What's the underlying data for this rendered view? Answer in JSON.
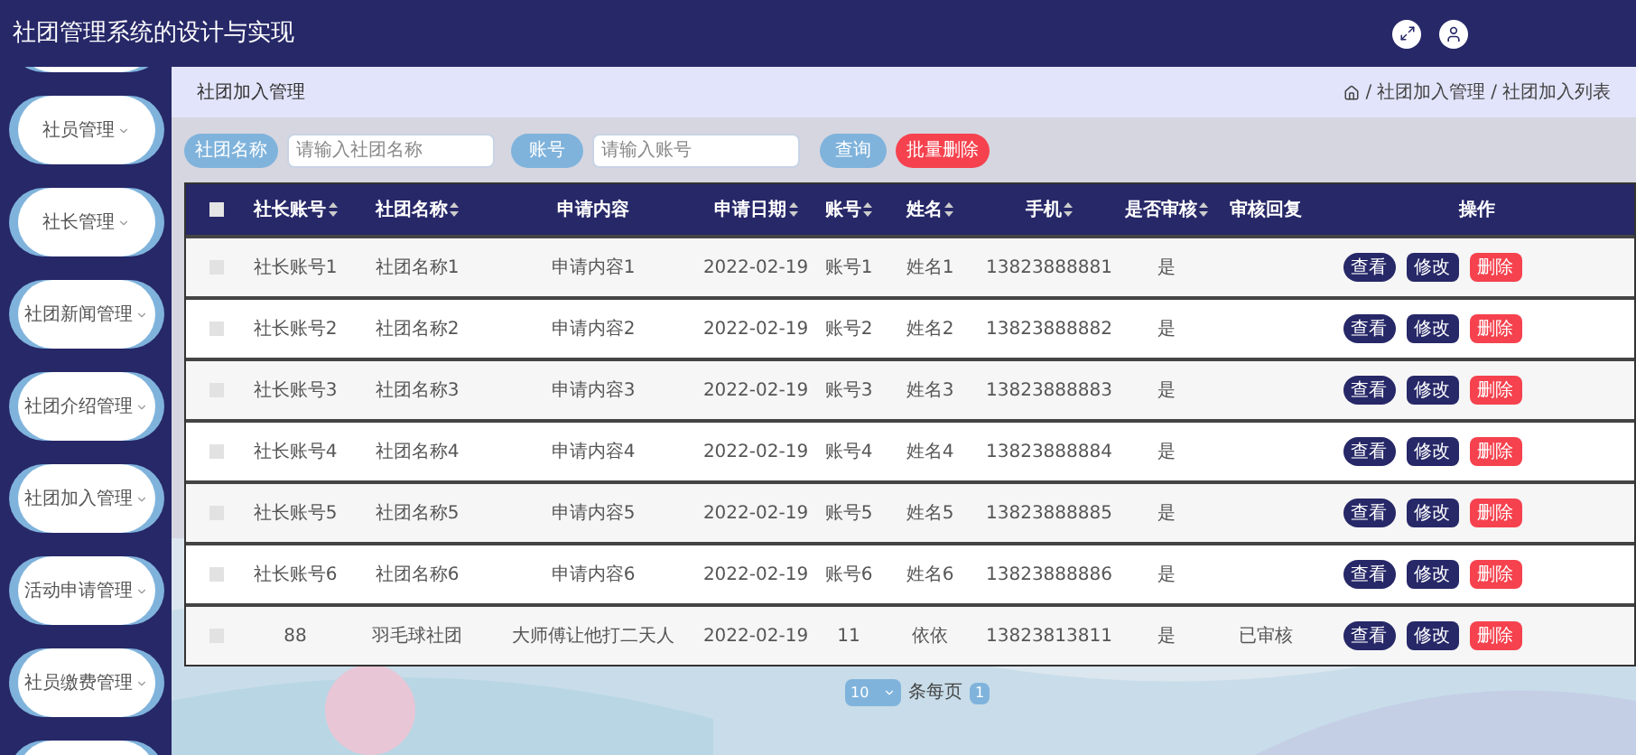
{
  "header": {
    "title": "社团管理系统的设计与实现"
  },
  "sidebar": {
    "items": [
      {
        "label": "社员管理"
      },
      {
        "label": "社长管理"
      },
      {
        "label": "社团新闻管理"
      },
      {
        "label": "社团介绍管理"
      },
      {
        "label": "社团加入管理"
      },
      {
        "label": "活动申请管理"
      },
      {
        "label": "社员缴费管理"
      }
    ]
  },
  "page_title": "社团加入管理",
  "breadcrumb": [
    {
      "separator": "/",
      "label": "社团加入管理"
    },
    {
      "separator": "/",
      "label": "社团加入列表"
    }
  ],
  "search": {
    "fields": [
      {
        "label": "社团名称",
        "placeholder": "请输入社团名称"
      },
      {
        "label": "账号",
        "placeholder": "请输入账号"
      }
    ],
    "query_button": "查询",
    "batch_delete_button": "批量删除"
  },
  "table": {
    "columns": [
      {
        "label": "社长账号",
        "sortable": true
      },
      {
        "label": "社团名称",
        "sortable": true
      },
      {
        "label": "申请内容",
        "sortable": false
      },
      {
        "label": "申请日期",
        "sortable": true
      },
      {
        "label": "账号",
        "sortable": true
      },
      {
        "label": "姓名",
        "sortable": true
      },
      {
        "label": "手机",
        "sortable": true
      },
      {
        "label": "是否审核",
        "sortable": true
      },
      {
        "label": "审核回复",
        "sortable": false
      },
      {
        "label": "操作",
        "sortable": false
      }
    ],
    "header_checked": false,
    "rows": [
      {
        "checked": false,
        "cells": [
          "社长账号1",
          "社团名称1",
          "申请内容1",
          "2022-02-19",
          "账号1",
          "姓名1",
          "13823888881",
          "是",
          ""
        ],
        "actions": [
          "查看",
          "修改",
          "删除"
        ]
      },
      {
        "checked": false,
        "cells": [
          "社长账号2",
          "社团名称2",
          "申请内容2",
          "2022-02-19",
          "账号2",
          "姓名2",
          "13823888882",
          "是",
          ""
        ],
        "actions": [
          "查看",
          "修改",
          "删除"
        ]
      },
      {
        "checked": false,
        "cells": [
          "社长账号3",
          "社团名称3",
          "申请内容3",
          "2022-02-19",
          "账号3",
          "姓名3",
          "13823888883",
          "是",
          ""
        ],
        "actions": [
          "查看",
          "修改",
          "删除"
        ]
      },
      {
        "checked": false,
        "cells": [
          "社长账号4",
          "社团名称4",
          "申请内容4",
          "2022-02-19",
          "账号4",
          "姓名4",
          "13823888884",
          "是",
          ""
        ],
        "actions": [
          "查看",
          "修改",
          "删除"
        ]
      },
      {
        "checked": false,
        "cells": [
          "社长账号5",
          "社团名称5",
          "申请内容5",
          "2022-02-19",
          "账号5",
          "姓名5",
          "13823888885",
          "是",
          ""
        ],
        "actions": [
          "查看",
          "修改",
          "删除"
        ]
      },
      {
        "checked": false,
        "cells": [
          "社长账号6",
          "社团名称6",
          "申请内容6",
          "2022-02-19",
          "账号6",
          "姓名6",
          "13823888886",
          "是",
          ""
        ],
        "actions": [
          "查看",
          "修改",
          "删除"
        ]
      },
      {
        "checked": false,
        "cells": [
          "88",
          "羽毛球社团",
          "大师傅让他打二天人",
          "2022-02-19",
          "11",
          "依依",
          "13823813811",
          "是",
          "已审核"
        ],
        "actions": [
          "查看",
          "修改",
          "删除"
        ]
      }
    ]
  },
  "pagination": {
    "page_size": "10",
    "page_size_label": "条每页",
    "pages": [
      {
        "label": "1",
        "selected": true
      }
    ]
  }
}
